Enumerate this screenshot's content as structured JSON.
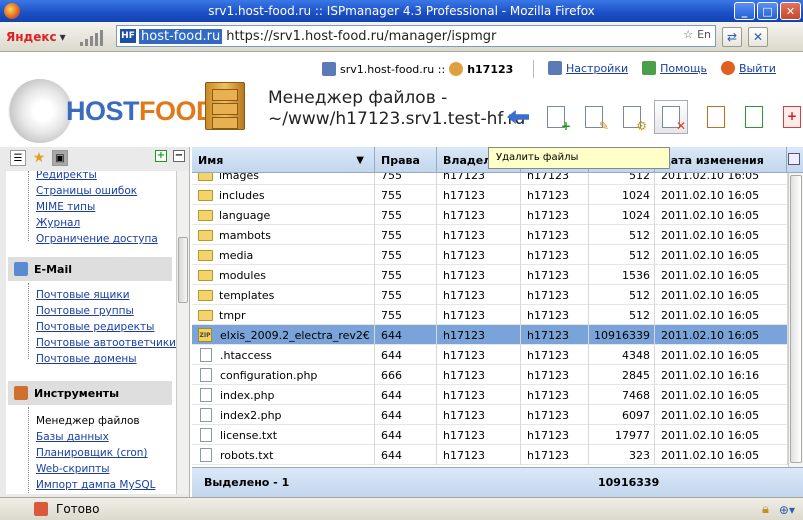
{
  "window": {
    "title": "srv1.host-food.ru :: ISPmanager 4.3 Professional - Mozilla Firefox",
    "min_label": "_",
    "max_label": "□",
    "close_label": "✕"
  },
  "browser": {
    "search_brand": "Яндекс",
    "search_arrow": "▾",
    "url_favicon": "HF",
    "url_host": "host-food.ru",
    "url_rest": "https://srv1.host-food.ru/manager/ispmgr",
    "url_lang": "En",
    "status_text": "Готово"
  },
  "header": {
    "server": "srv1.host-food.ru ::",
    "user": "h17123",
    "links": [
      {
        "label": "Настройки",
        "icon": "settings-icon"
      },
      {
        "label": "Помощь",
        "icon": "help-icon"
      },
      {
        "label": "Выйти",
        "icon": "logout-icon"
      }
    ],
    "logo_host": "HOST",
    "logo_food": "FOOD",
    "page_title_line1": "Менеджер файлов -",
    "page_title_line2": "~/www/h17123.srv1.test-hf.ru",
    "tooltip": "Удалить файлы"
  },
  "sidebar": {
    "tab_icons": [
      "list-icon",
      "star-icon",
      "briefcase-icon"
    ],
    "group_top_items": [
      "Редиректы",
      "Страницы ошибок",
      "MIME типы",
      "Журнал",
      "Ограничение доступа"
    ],
    "email_title": "E-Mail",
    "email_items": [
      "Почтовые ящики",
      "Почтовые группы",
      "Почтовые редиректы",
      "Почтовые автоответчики",
      "Почтовые домены"
    ],
    "tools_title": "Инструменты",
    "tools_items": [
      "Менеджер файлов",
      "Базы данных",
      "Планировщик (cron)",
      "Web-скрипты",
      "Импорт дампа MySQL"
    ]
  },
  "grid": {
    "columns": [
      "Имя",
      "Права",
      "Владелец",
      "",
      "",
      "Дата изменения"
    ],
    "rows": [
      {
        "type": "folder",
        "name": "images",
        "perm": "755",
        "owner": "h17123",
        "group": "h17123",
        "size": "512",
        "date": "2011.02.10 16:05"
      },
      {
        "type": "folder",
        "name": "includes",
        "perm": "755",
        "owner": "h17123",
        "group": "h17123",
        "size": "1024",
        "date": "2011.02.10 16:05"
      },
      {
        "type": "folder",
        "name": "language",
        "perm": "755",
        "owner": "h17123",
        "group": "h17123",
        "size": "1024",
        "date": "2011.02.10 16:05"
      },
      {
        "type": "folder",
        "name": "mambots",
        "perm": "755",
        "owner": "h17123",
        "group": "h17123",
        "size": "512",
        "date": "2011.02.10 16:05"
      },
      {
        "type": "folder",
        "name": "media",
        "perm": "755",
        "owner": "h17123",
        "group": "h17123",
        "size": "512",
        "date": "2011.02.10 16:05"
      },
      {
        "type": "folder",
        "name": "modules",
        "perm": "755",
        "owner": "h17123",
        "group": "h17123",
        "size": "1536",
        "date": "2011.02.10 16:05"
      },
      {
        "type": "folder",
        "name": "templates",
        "perm": "755",
        "owner": "h17123",
        "group": "h17123",
        "size": "512",
        "date": "2011.02.10 16:05"
      },
      {
        "type": "folder",
        "name": "tmpr",
        "perm": "755",
        "owner": "h17123",
        "group": "h17123",
        "size": "512",
        "date": "2011.02.10 16:05"
      },
      {
        "type": "zip",
        "name": "elxis_2009.2_electra_rev2€",
        "perm": "644",
        "owner": "h17123",
        "group": "h17123",
        "size": "10916339",
        "date": "2011.02.10 16:05",
        "selected": true
      },
      {
        "type": "file",
        "name": ".htaccess",
        "perm": "644",
        "owner": "h17123",
        "group": "h17123",
        "size": "4348",
        "date": "2011.02.10 16:05"
      },
      {
        "type": "file",
        "name": "configuration.php",
        "perm": "666",
        "owner": "h17123",
        "group": "h17123",
        "size": "2845",
        "date": "2011.02.10 16:16"
      },
      {
        "type": "file",
        "name": "index.php",
        "perm": "644",
        "owner": "h17123",
        "group": "h17123",
        "size": "7468",
        "date": "2011.02.10 16:05"
      },
      {
        "type": "file",
        "name": "index2.php",
        "perm": "644",
        "owner": "h17123",
        "group": "h17123",
        "size": "6097",
        "date": "2011.02.10 16:05"
      },
      {
        "type": "file",
        "name": "license.txt",
        "perm": "644",
        "owner": "h17123",
        "group": "h17123",
        "size": "17977",
        "date": "2011.02.10 16:05"
      },
      {
        "type": "file",
        "name": "robots.txt",
        "perm": "644",
        "owner": "h17123",
        "group": "h17123",
        "size": "323",
        "date": "2011.02.10 16:05"
      }
    ],
    "footer_label": "Выделено - 1",
    "footer_size": "10916339",
    "zip_label": "ZIP"
  }
}
